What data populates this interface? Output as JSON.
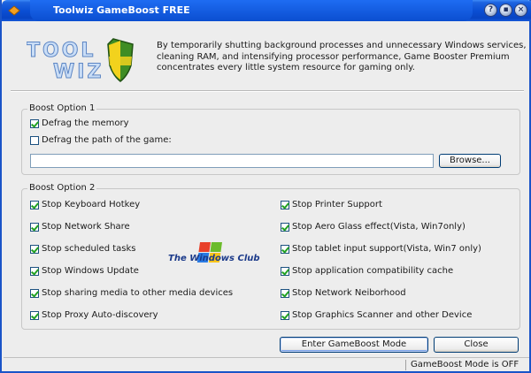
{
  "window": {
    "title": "Toolwiz GameBoost FREE"
  },
  "header": {
    "logo_line1": "TOOL",
    "logo_line2": "WIZ",
    "description": "By temporarily shutting background processes and unnecessary Windows services, cleaning RAM, and intensifying processor performance, Game Booster Premium concentrates every little system resource for gaming only."
  },
  "boost_option_1": {
    "title": "Boost Option 1",
    "defrag_memory": {
      "label": "Defrag the memory",
      "checked": true
    },
    "defrag_path": {
      "label": "Defrag the path of the game:",
      "checked": false
    },
    "path_value": "",
    "browse_label": "Browse..."
  },
  "boost_option_2": {
    "title": "Boost Option 2",
    "left": [
      {
        "label": "Stop Keyboard Hotkey",
        "checked": true
      },
      {
        "label": "Stop Network Share",
        "checked": true
      },
      {
        "label": "Stop scheduled tasks",
        "checked": true
      },
      {
        "label": "Stop Windows Update",
        "checked": true
      },
      {
        "label": "Stop sharing media to other media devices",
        "checked": true
      },
      {
        "label": "Stop Proxy Auto-discovery",
        "checked": true
      }
    ],
    "right": [
      {
        "label": "Stop Printer Support",
        "checked": true
      },
      {
        "label": "Stop Aero Glass effect(Vista, Win7only)",
        "checked": true
      },
      {
        "label": "Stop tablet input support(Vista, Win7 only)",
        "checked": true
      },
      {
        "label": "Stop application compatibility cache",
        "checked": true
      },
      {
        "label": "Stop Network Neiborhood",
        "checked": true
      },
      {
        "label": "Stop Graphics Scanner and other Device",
        "checked": true
      }
    ]
  },
  "watermark": {
    "text": "The Windows Club"
  },
  "buttons": {
    "enter": "Enter GameBoost Mode",
    "close": "Close"
  },
  "status": {
    "text": "GameBoost Mode is OFF"
  },
  "colors": {
    "titlebar": "#0a4fd4",
    "check": "#21a121",
    "background": "#ededed"
  }
}
